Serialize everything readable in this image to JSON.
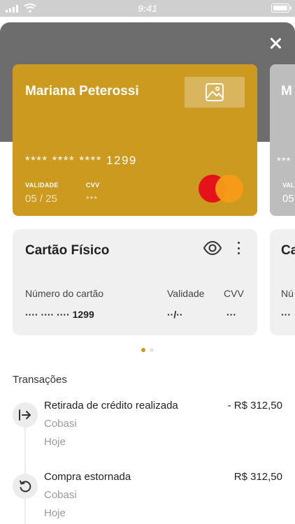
{
  "status_bar": {
    "time": "9:41"
  },
  "card": {
    "holder": "Mariana Peterossi",
    "number": "**** **** **** 1299",
    "validity_label": "VALIDADE",
    "validity_value": "05 / 25",
    "cvv_label": "CVV",
    "cvv_value": "***",
    "color": "#cb9a1f",
    "brand_icon": "mastercard-logo"
  },
  "next_card": {
    "holder_initial": "M",
    "number_partial": "***",
    "label_partial": "VAL",
    "value_partial": "05"
  },
  "card_info": {
    "title": "Cartão Físico",
    "number_label": "Número do cartão",
    "number_value": "···· ···· ···· 1299",
    "validity_label": "Validade",
    "validity_value": "··/··",
    "cvv_label": "CVV",
    "cvv_value": "···"
  },
  "next_card_info": {
    "title_partial": "Ca",
    "label_partial": "Nú",
    "value_partial": "···"
  },
  "pager": {
    "active_color": "#cb9a1f"
  },
  "transactions": {
    "title": "Transações",
    "items": [
      {
        "title": "Retirada de crédito realizada",
        "amount": "- R$ 312,50",
        "merchant": "Cobasi",
        "date": "Hoje",
        "icon": "withdraw-arrow-icon"
      },
      {
        "title": "Compra estornada",
        "amount": "R$ 312,50",
        "merchant": "Cobasi",
        "date": "Hoje",
        "icon": "refund-icon"
      }
    ]
  }
}
